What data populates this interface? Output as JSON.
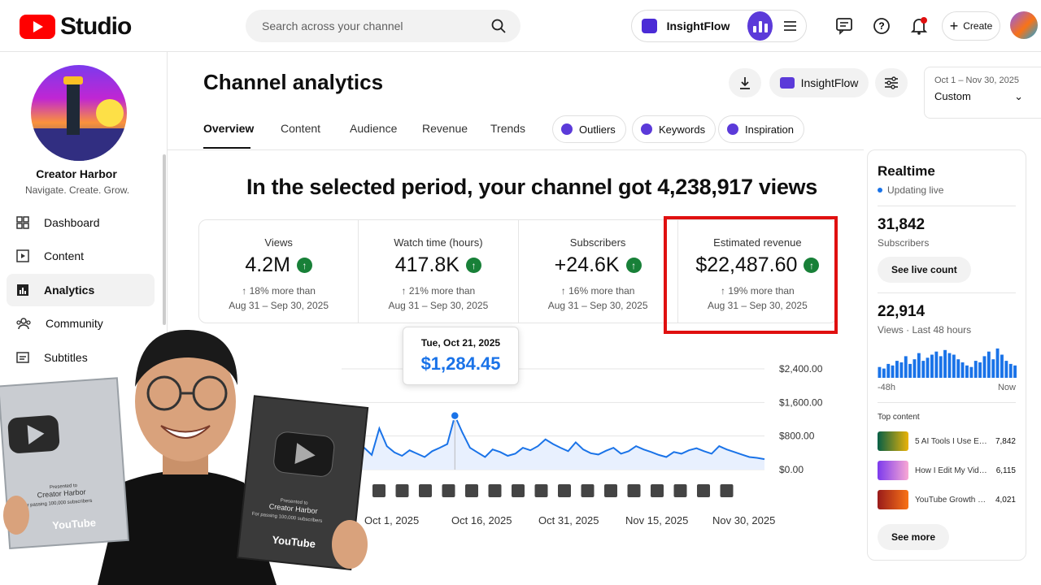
{
  "header": {
    "logo_text": "Studio",
    "search_placeholder": "Search across your channel",
    "insightflow_label": "InsightFlow",
    "create_label": "Create"
  },
  "sidebar": {
    "channel_name": "Creator Harbor",
    "channel_tagline": "Navigate. Create. Grow.",
    "items": [
      {
        "label": "Dashboard",
        "icon": "dashboard-icon"
      },
      {
        "label": "Content",
        "icon": "content-icon"
      },
      {
        "label": "Analytics",
        "icon": "analytics-icon",
        "active": true
      },
      {
        "label": "Community",
        "icon": "community-icon"
      },
      {
        "label": "Subtitles",
        "icon": "subtitles-icon"
      }
    ]
  },
  "page": {
    "title": "Channel analytics",
    "insightflow_label": "InsightFlow",
    "date_range": "Oct 1 – Nov 30, 2025",
    "date_mode": "Custom",
    "tabs": [
      "Overview",
      "Content",
      "Audience",
      "Revenue",
      "Trends"
    ],
    "chips": [
      "Outliers",
      "Keywords",
      "Inspiration"
    ],
    "headline": "In the selected period, your channel got 4,238,917 views"
  },
  "metrics": [
    {
      "label": "Views",
      "value": "4.2M",
      "change": "↑ 18% more than",
      "period": "Aug 31 – Sep 30, 2025"
    },
    {
      "label": "Watch time (hours)",
      "value": "417.8K",
      "change": "↑ 21% more than",
      "period": "Aug 31 – Sep 30, 2025"
    },
    {
      "label": "Subscribers",
      "value": "+24.6K",
      "change": "↑ 16% more than",
      "period": "Aug 31 – Sep 30, 2025"
    },
    {
      "label": "Estimated revenue",
      "value": "$22,487.60",
      "change": "↑ 19% more than",
      "period": "Aug 31 – Sep 30, 2025"
    }
  ],
  "tooltip": {
    "date": "Tue, Oct 21, 2025",
    "value": "$1,284.45"
  },
  "chart_data": {
    "type": "line",
    "title": "",
    "ylabel": "",
    "xlabel": "",
    "y_ticks": [
      "$2,400.00",
      "$1,600.00",
      "$800.00",
      "$0.00"
    ],
    "x_ticks": [
      "Oct 1, 2025",
      "Oct 16, 2025",
      "Oct 31, 2025",
      "Nov 15, 2025",
      "Nov 30, 2025"
    ],
    "ylim": [
      0,
      2400
    ],
    "series": [
      {
        "values": [
          420,
          390,
          640,
          520,
          350,
          980,
          560,
          410,
          330,
          460,
          380,
          300,
          440,
          520,
          610,
          1284,
          880,
          520,
          410,
          300,
          480,
          420,
          330,
          380,
          520,
          460,
          560,
          720,
          610,
          520,
          440,
          650,
          480,
          390,
          360,
          450,
          520,
          380,
          440,
          560,
          480,
          420,
          350,
          300,
          420,
          380,
          460,
          510,
          440,
          380,
          560,
          480,
          420,
          360,
          300,
          280,
          250
        ]
      }
    ],
    "line_color": "#1a73e8",
    "highlight_index": 15,
    "markers": [
      "play",
      "s",
      "play",
      "play",
      "play",
      "s",
      "play",
      "2",
      "doc",
      "g",
      "2",
      "2",
      "flag",
      "play",
      "2",
      "play"
    ]
  },
  "realtime": {
    "title": "Realtime",
    "status": "Updating live",
    "subscribers_value": "31,842",
    "subscribers_label": "Subscribers",
    "live_count_button": "See live count",
    "views_value": "22,914",
    "views_label": "Views · Last 48 hours",
    "axis_start": "-48h",
    "axis_end": "Now",
    "bars": [
      0.35,
      0.3,
      0.45,
      0.4,
      0.55,
      0.5,
      0.7,
      0.45,
      0.6,
      0.8,
      0.55,
      0.65,
      0.75,
      0.85,
      0.7,
      0.9,
      0.8,
      0.75,
      0.6,
      0.5,
      0.4,
      0.35,
      0.55,
      0.5,
      0.7,
      0.85,
      0.6,
      0.95,
      0.75,
      0.55,
      0.45,
      0.4
    ],
    "top_content_label": "Top content",
    "top_content": [
      {
        "title": "5 AI Tools I Use Ev...",
        "views": "7,842"
      },
      {
        "title": "How I Edit My Videos",
        "views": "6,115"
      },
      {
        "title": "YouTube Growth S...",
        "views": "4,021"
      }
    ],
    "see_more": "See more"
  },
  "plaques": {
    "left_presented": "Presented to",
    "left_name": "Creator Harbor",
    "left_sub": "For passing 100,000 subscribers",
    "right_presented": "Presented to",
    "right_name": "Creator Harbor",
    "right_sub": "For passing 100,000 subscribers",
    "brand": "YouTube"
  }
}
